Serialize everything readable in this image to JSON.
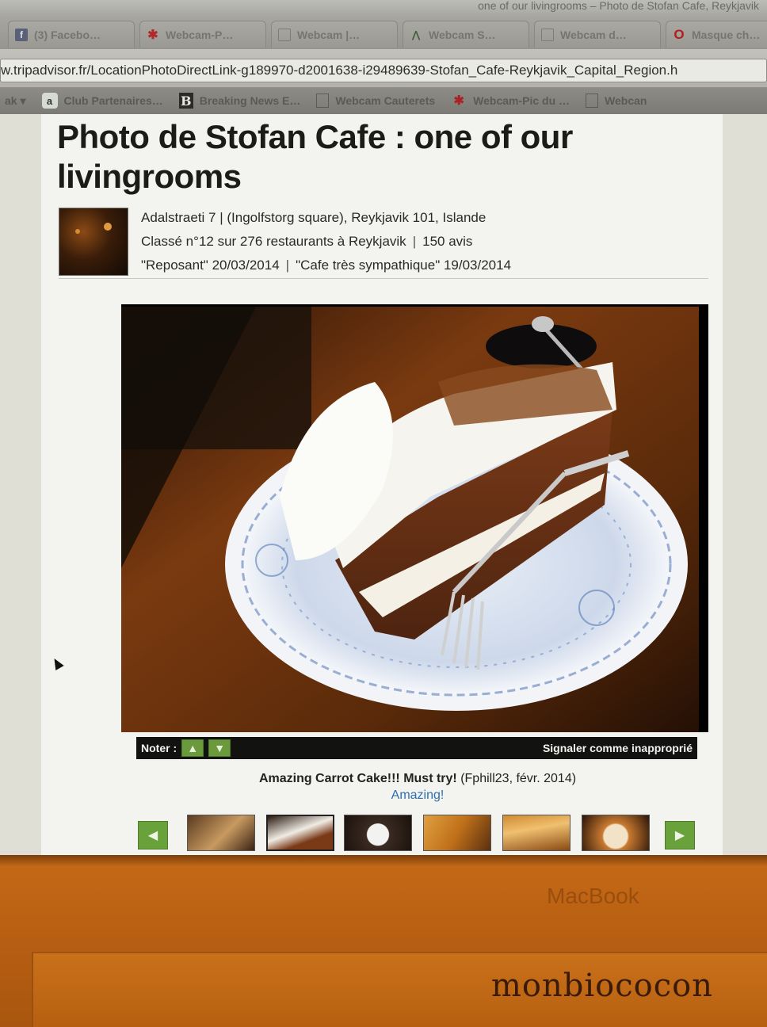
{
  "window": {
    "title": "one of our livingrooms – Photo de Stofan Cafe, Reykjavik"
  },
  "tabs": [
    {
      "label": "(3) Facebo…",
      "icon": "facebook-icon"
    },
    {
      "label": "Webcam-P…",
      "icon": "pin-icon"
    },
    {
      "label": "Webcam |…",
      "icon": "page-icon"
    },
    {
      "label": "Webcam S…",
      "icon": "mountain-icon"
    },
    {
      "label": "Webcam d…",
      "icon": "page-icon"
    },
    {
      "label": "Masque ch…",
      "icon": "opera-icon"
    }
  ],
  "address": {
    "url": "w.tripadvisor.fr/LocationPhotoDirectLink-g189970-d2001638-i29489639-Stofan_Cafe-Reykjavik_Capital_Region.h"
  },
  "bookmarks": [
    {
      "label": "Club Partenaires…",
      "icon": "amazon-icon"
    },
    {
      "label": "Breaking News E…",
      "icon": "b-icon"
    },
    {
      "label": "Webcam Cauterets",
      "icon": "page-icon"
    },
    {
      "label": "Webcam-Pic du …",
      "icon": "pin-icon"
    },
    {
      "label": "Webcan",
      "icon": "page-icon"
    }
  ],
  "page": {
    "title": "Photo de Stofan Cafe : one of our livingrooms",
    "address": "Adalstraeti 7 | (Ingolfstorg square), Reykjavik 101, Islande",
    "rank": "Classé n°12 sur 276 restaurants à Reykjavik",
    "reviews": "150 avis",
    "review1": "\"Reposant\" 20/03/2014",
    "review2": "\"Cafe très sympathique\" 19/03/2014",
    "vote_label": "Noter :",
    "report_label": "Signaler comme inapproprié",
    "caption_bold": "Amazing Carrot Cake!!! Must try!",
    "caption_meta": "(Fphill23, févr. 2014)",
    "caption_sub": "Amazing!"
  },
  "device": {
    "brand": "MacBook",
    "watermark": "monbiococon"
  },
  "colors": {
    "accent_green": "#69a13a",
    "link_blue": "#2f6fb0"
  }
}
